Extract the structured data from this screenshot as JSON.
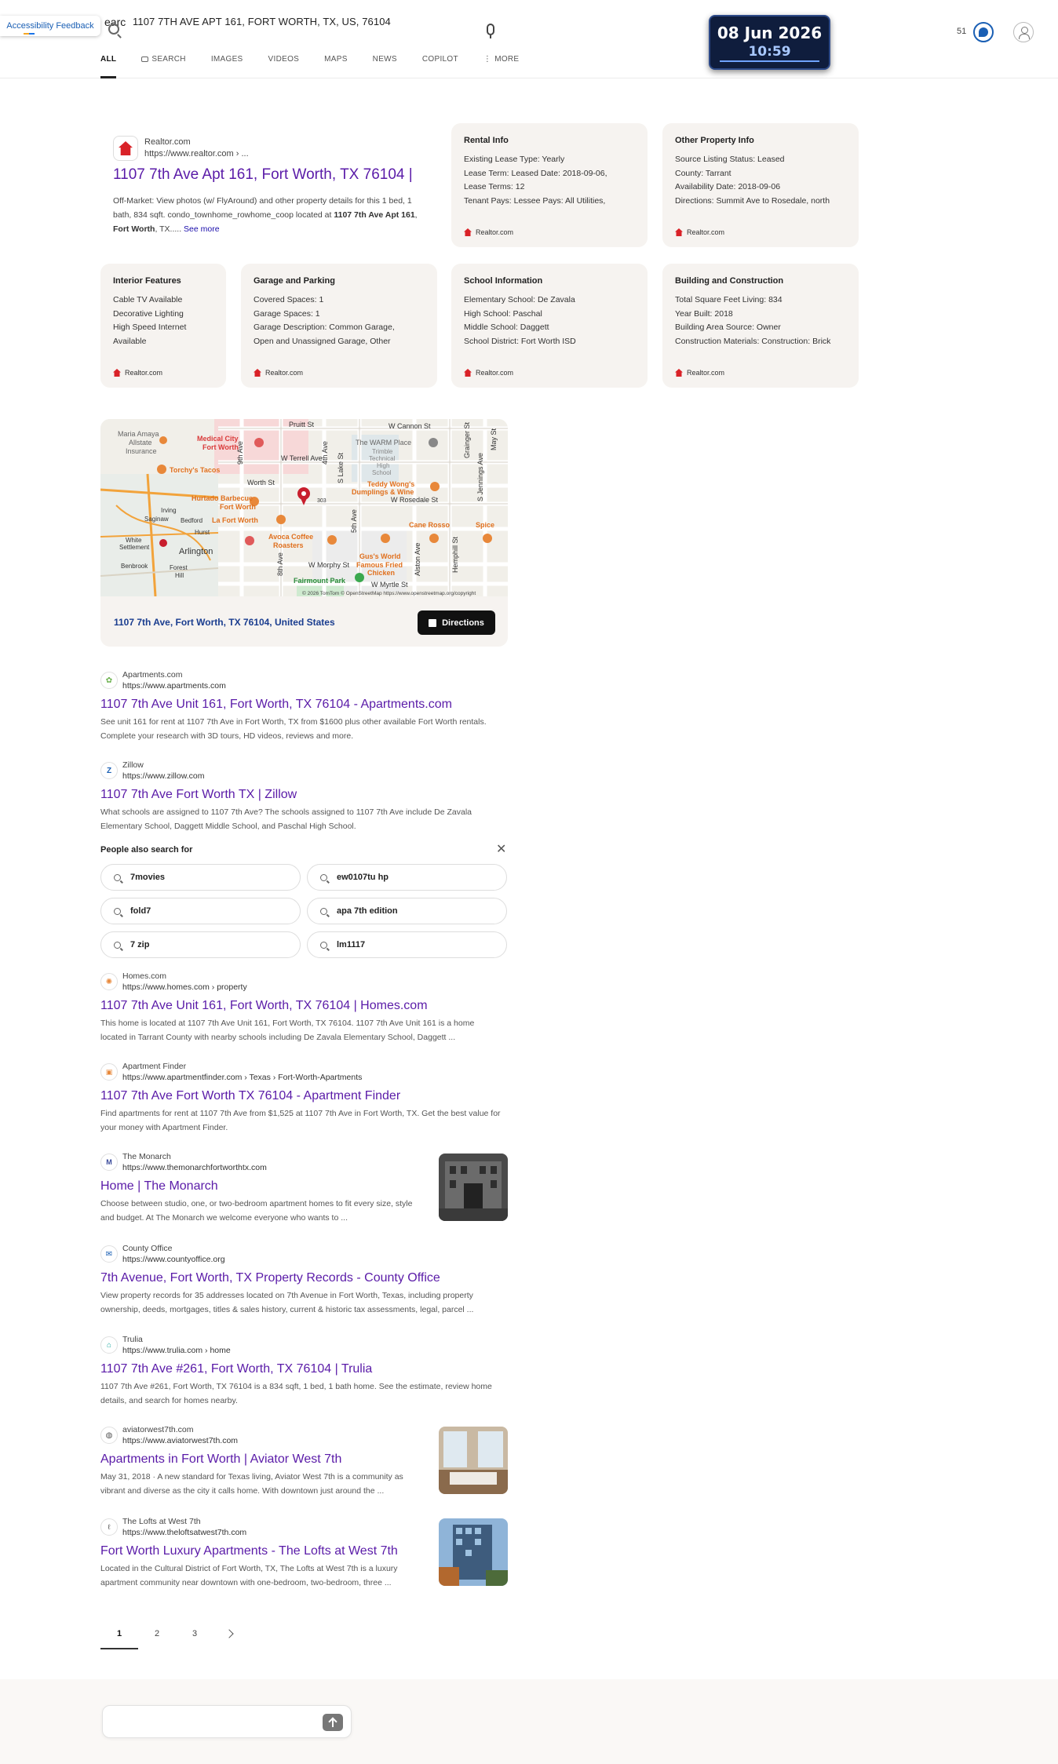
{
  "header": {
    "accessibility_label": "Accessibility Feedback",
    "search_stub": "earc",
    "query": "1107 7TH AVE APT 161, FORT WORTH, TX, US, 76104",
    "clock_date": "08 Jun 2026",
    "clock_time": "10:59",
    "points": "51"
  },
  "tabs": [
    {
      "label": "ALL"
    },
    {
      "label": "SEARCH"
    },
    {
      "label": "IMAGES"
    },
    {
      "label": "VIDEOS"
    },
    {
      "label": "MAPS"
    },
    {
      "label": "NEWS"
    },
    {
      "label": "COPILOT"
    },
    {
      "label": "MORE"
    }
  ],
  "main_result": {
    "site": "Realtor.com",
    "url": "https://www.realtor.com › ...",
    "title": "1107 7th Ave Apt 161, Fort Worth, TX 76104 |",
    "desc_1": "Off-Market: View photos (w/ FlyAround) and other property details for this 1 bed, 1 bath, 834 sqft. condo_townhome_rowhome_coop located at ",
    "desc_bold_1": "1107 7th Ave Apt 161",
    "desc_2": ", ",
    "desc_bold_2": "Fort Worth",
    "desc_3": ", TX.....",
    "see_more": "See more"
  },
  "cards": {
    "source": "Realtor.com",
    "rental": {
      "title": "Rental Info",
      "lines": [
        "Existing Lease Type: Yearly",
        "Lease Term: Leased Date: 2018-09-06,",
        "Lease Terms: 12",
        "Tenant Pays: Lessee Pays: All Utilities,"
      ]
    },
    "other": {
      "title": "Other Property Info",
      "lines": [
        "Source Listing Status: Leased",
        "County: Tarrant",
        "Availability Date: 2018-09-06",
        "Directions: Summit Ave to Rosedale, north"
      ]
    },
    "interior": {
      "title": "Interior Features",
      "lines": [
        "Cable TV Available",
        "Decorative Lighting",
        "High Speed Internet",
        "Available"
      ]
    },
    "garage": {
      "title": "Garage and Parking",
      "lines": [
        "Covered Spaces: 1",
        "Garage Spaces: 1",
        "Garage Description: Common Garage,",
        "Open and Unassigned Garage, Other"
      ]
    },
    "school": {
      "title": "School Information",
      "lines": [
        "Elementary School: De Zavala",
        "High School: Paschal",
        "Middle School: Daggett",
        "School District: Fort Worth ISD"
      ]
    },
    "building": {
      "title": "Building and Construction",
      "lines": [
        "Total Square Feet Living: 834",
        "Year Built: 2018",
        "Building Area Source: Owner",
        "Construction Materials: Construction: Brick"
      ]
    }
  },
  "map": {
    "labels": {
      "maria": "Maria Amaya",
      "allstate": "Allstate",
      "insurance": "Insurance",
      "medical": "Medical City",
      "medical2": "Fort Worth",
      "torchys": "Torchy's Tacos",
      "hurtado": "Hurtado Barbecue",
      "hurtado2": "Fort Worth",
      "lafort": "La Fort Worth",
      "avoca": "Avoca Coffee",
      "avoca2": "Roasters",
      "teddy": "Teddy Wong's",
      "teddy2": "Dumplings & Wine",
      "warm": "The WARM Place",
      "trimble": "Trimble",
      "technical": "Technical",
      "high": "High",
      "school": "School",
      "cane": "Cane Rosso",
      "spice": "Spice",
      "gus": "Gus's World",
      "gus2": "Famous Fried",
      "gus3": "Chicken",
      "fairmount": "Fairmount Park",
      "pruitt": "Pruitt St",
      "cannon": "W Cannon St",
      "terrell": "W Terrell Ave",
      "worth": "Worth St",
      "rosedale": "W Rosedale St",
      "morphy": "W Morphy St",
      "myrtle": "W Myrtle St",
      "ninth": "9th Ave",
      "fourth": "4th Ave",
      "lake": "S Lake St",
      "fifth": "5th Ave",
      "eighth": "8th Ave",
      "alston": "Alston Ave",
      "hemphill": "Hemphill St",
      "grainger": "Grainger St",
      "jennings": "S Jennings Ave",
      "may": "May St",
      "saginaw": "Saginaw",
      "bedford": "Bedford",
      "hurst": "Hurst",
      "white": "White",
      "settlement": "Settlement",
      "arlington": "Arlington",
      "benbrook": "Benbrook",
      "forest": "Forest",
      "hill": "Hill",
      "irving": "Irving",
      "hwy": "303",
      "attribution": "© 2026 TomTom © OpenStreetMap https://www.openstreetmap.org/copyright"
    },
    "address": "1107 7th Ave, Fort Worth, TX 76104, United States",
    "directions_label": "Directions"
  },
  "results": [
    {
      "site": "Apartments.com",
      "url": "https://www.apartments.com",
      "title": "1107 7th Ave Unit 161, Fort Worth, TX 76104 - Apartments.com",
      "desc": "See unit 161 for rent at 1107 7th Ave in Fort Worth, TX from $1600 plus other available Fort Worth rentals. Complete your research with 3D tours, HD videos, reviews and more."
    },
    {
      "site": "Zillow",
      "url": "https://www.zillow.com",
      "title": "1107 7th Ave Fort Worth TX | Zillow",
      "desc": "What schools are assigned to 1107 7th Ave? The schools assigned to 1107 7th Ave include De Zavala Elementary School, Daggett Middle School, and Paschal High School."
    },
    {
      "site": "Homes.com",
      "url": "https://www.homes.com › property",
      "title": "1107 7th Ave Unit 161, Fort Worth, TX 76104 | Homes.com",
      "desc": "This home is located at 1107 7th Ave Unit 161, Fort Worth, TX 76104. 1107 7th Ave Unit 161 is a home located in Tarrant County with nearby schools including De Zavala Elementary School, Daggett ..."
    },
    {
      "site": "Apartment Finder",
      "url": "https://www.apartmentfinder.com › Texas › Fort-Worth-Apartments",
      "title": "1107 7th Ave Fort Worth TX 76104 - Apartment Finder",
      "desc": "Find apartments for rent at 1107 7th Ave from $1,525 at 1107 7th Ave in Fort Worth, TX. Get the best value for your money with Apartment Finder."
    },
    {
      "site": "The Monarch",
      "url": "https://www.themonarchfortworthtx.com",
      "title": "Home | The Monarch",
      "desc": "Choose between studio, one, or two-bedroom apartment homes to fit every size, style and budget. At The Monarch we welcome everyone who wants to ..."
    },
    {
      "site": "County Office",
      "url": "https://www.countyoffice.org",
      "title": "7th Avenue, Fort Worth, TX Property Records - County Office",
      "desc": "View property records for 35 addresses located on 7th Avenue in Fort Worth, Texas, including property ownership, deeds, mortgages, titles & sales history, current & historic tax assessments, legal, parcel ..."
    },
    {
      "site": "Trulia",
      "url": "https://www.trulia.com › home",
      "title": "1107 7th Ave #261, Fort Worth, TX 76104 | Trulia",
      "desc": "1107 7th Ave #261, Fort Worth, TX 76104 is a 834 sqft, 1 bed, 1 bath home. See the estimate, review home details, and search for homes nearby."
    },
    {
      "site": "aviatorwest7th.com",
      "url": "https://www.aviatorwest7th.com",
      "title": "Apartments in Fort Worth | Aviator West 7th",
      "desc": "May 31, 2018 · A new standard for Texas living, Aviator West 7th is a community as vibrant and diverse as the city it calls home. With downtown just around the ..."
    },
    {
      "site": "The Lofts at West 7th",
      "url": "https://www.theloftsatwest7th.com",
      "title": "Fort Worth Luxury Apartments - The Lofts at West 7th",
      "desc": "Located in the Cultural District of Fort Worth, TX, The Lofts at West 7th is a luxury apartment community near downtown with one-bedroom, two-bedroom, three ..."
    }
  ],
  "people_also_search": {
    "title": "People also search for",
    "items": [
      "7movies",
      "ew0107tu hp",
      "fold7",
      "apa 7th edition",
      "7 zip",
      "lm1117"
    ]
  },
  "pagination": {
    "pages": [
      "1",
      "2",
      "3"
    ]
  }
}
